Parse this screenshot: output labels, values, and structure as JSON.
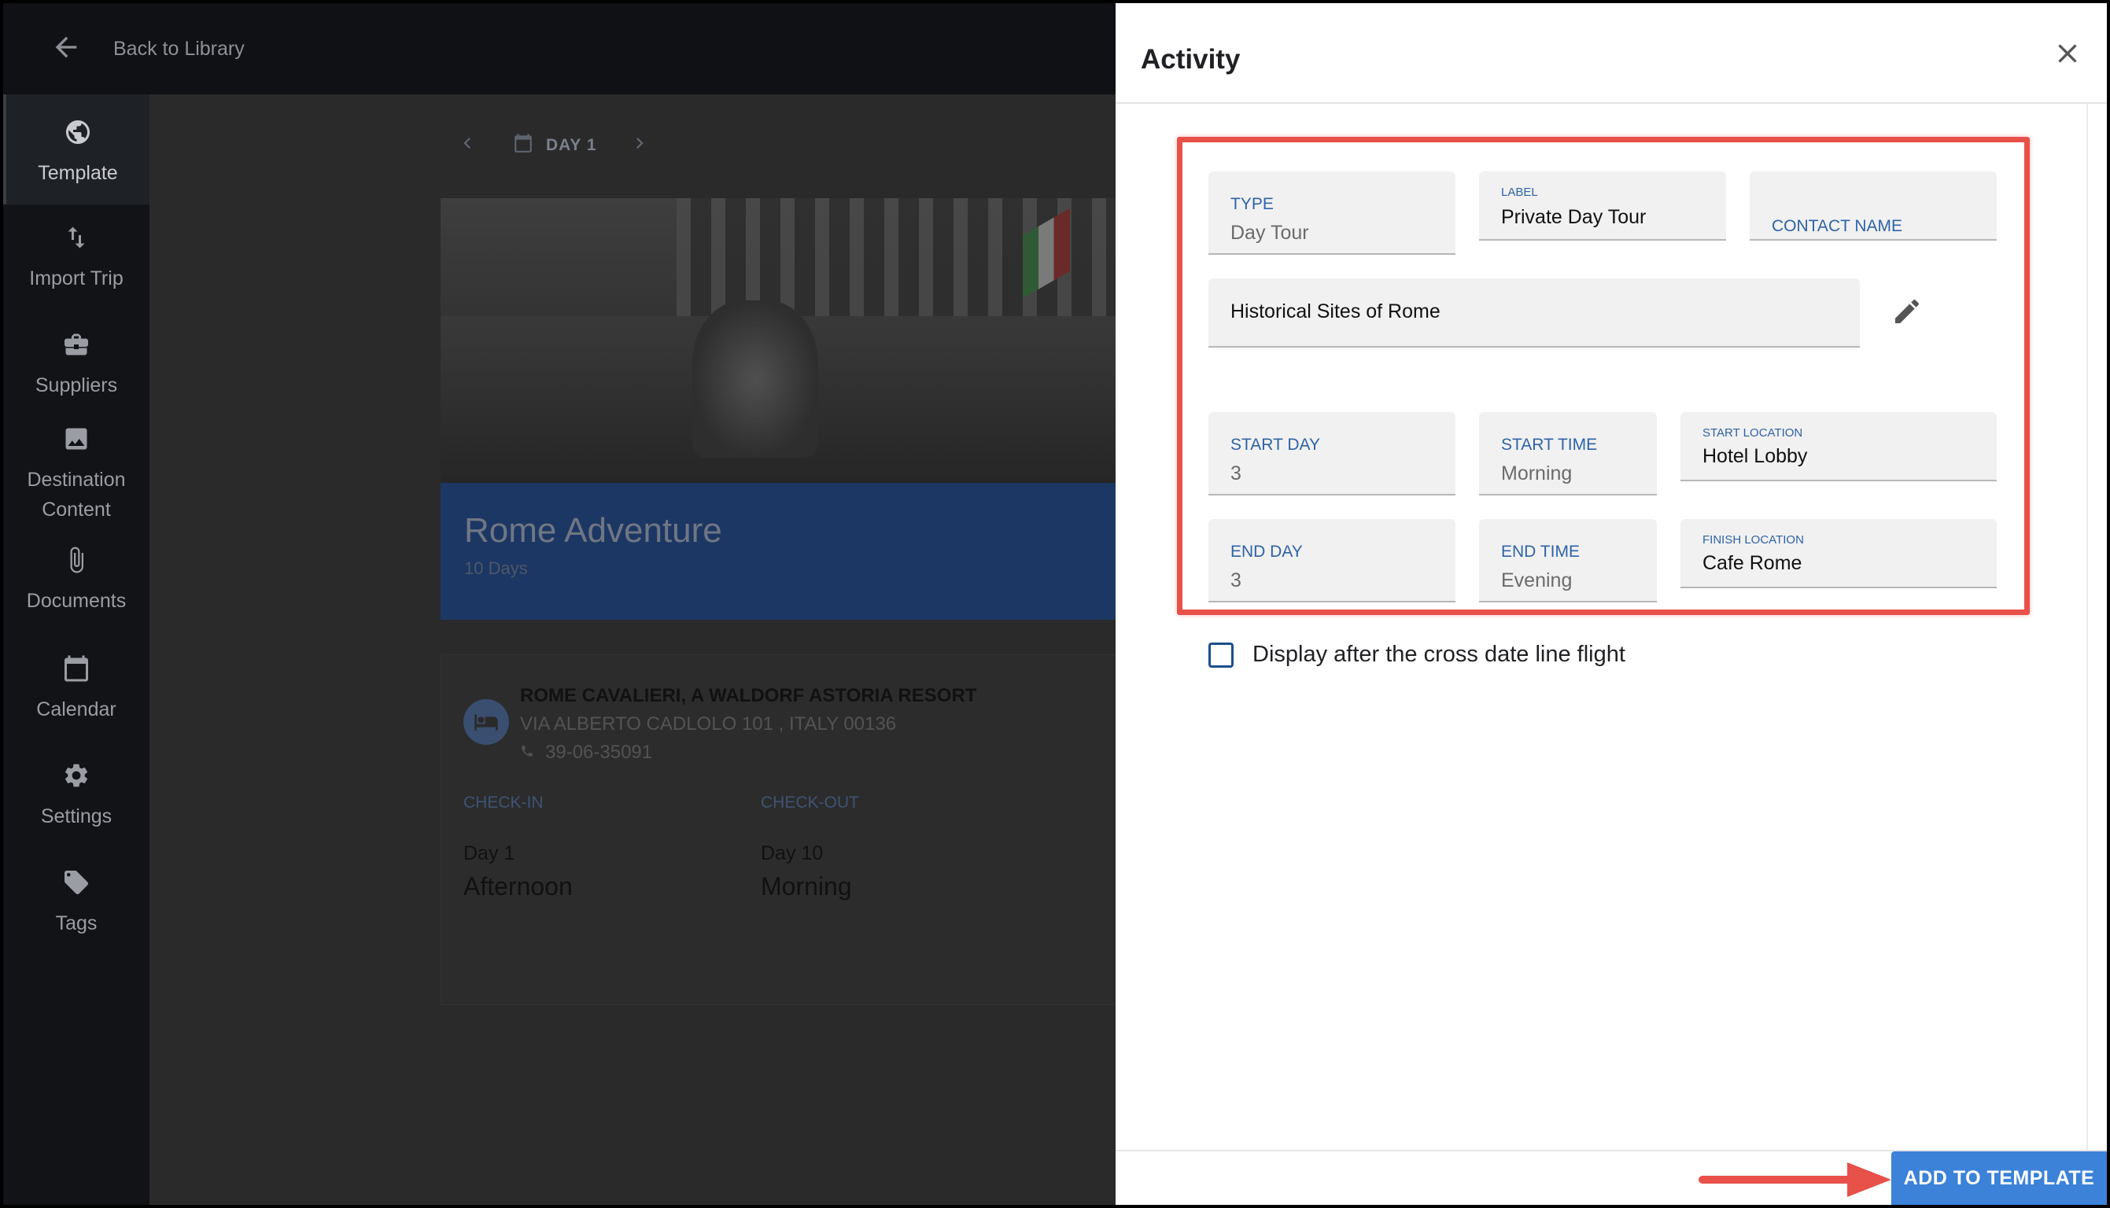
{
  "topbar": {
    "back_label": "Back to Library"
  },
  "sidebar": {
    "items": [
      {
        "label": "Template",
        "icon": "globe-icon",
        "active": true
      },
      {
        "label": "Import Trip",
        "icon": "swap-vertical-icon"
      },
      {
        "label": "Suppliers",
        "icon": "briefcase-icon"
      },
      {
        "label": "Destination Content",
        "icon": "image-icon"
      },
      {
        "label": "Documents",
        "icon": "paperclip-icon"
      },
      {
        "label": "Calendar",
        "icon": "calendar-icon"
      },
      {
        "label": "Settings",
        "icon": "gear-icon"
      },
      {
        "label": "Tags",
        "icon": "tag-icon"
      }
    ]
  },
  "daynav": {
    "label": "DAY 1"
  },
  "trip": {
    "title": "Rome Adventure",
    "duration": "10 Days"
  },
  "hotel": {
    "name": "ROME CAVALIERI, A WALDORF ASTORIA RESORT",
    "address": "VIA ALBERTO CADLOLO 101 , ITALY 00136",
    "phone": "39-06-35091",
    "checkin_label": "CHECK-IN",
    "checkout_label": "CHECK-OUT",
    "checkin_day": "Day 1",
    "checkin_time": "Afternoon",
    "checkout_day": "Day 10",
    "checkout_time": "Morning"
  },
  "panel": {
    "title": "Activity",
    "fields": {
      "type": {
        "label": "TYPE",
        "value": "Day Tour"
      },
      "label": {
        "label": "LABEL",
        "value": "Private Day Tour"
      },
      "contact": {
        "label": "CONTACT NAME",
        "value": ""
      },
      "name": {
        "value": "Historical Sites of Rome"
      },
      "start_day": {
        "label": "START DAY",
        "value": "3"
      },
      "start_time": {
        "label": "START TIME",
        "value": "Morning"
      },
      "start_location": {
        "label": "START LOCATION",
        "value": "Hotel Lobby"
      },
      "end_day": {
        "label": "END DAY",
        "value": "3"
      },
      "end_time": {
        "label": "END TIME",
        "value": "Evening"
      },
      "finish_location": {
        "label": "FINISH LOCATION",
        "value": "Cafe Rome"
      }
    },
    "checkbox_label": "Display after the cross date line flight",
    "checkbox_checked": false,
    "add_button": "ADD TO TEMPLATE"
  },
  "colors": {
    "accent_blue": "#3b82d8",
    "field_label_blue": "#2e63a8",
    "highlight_red": "#e8504a"
  }
}
